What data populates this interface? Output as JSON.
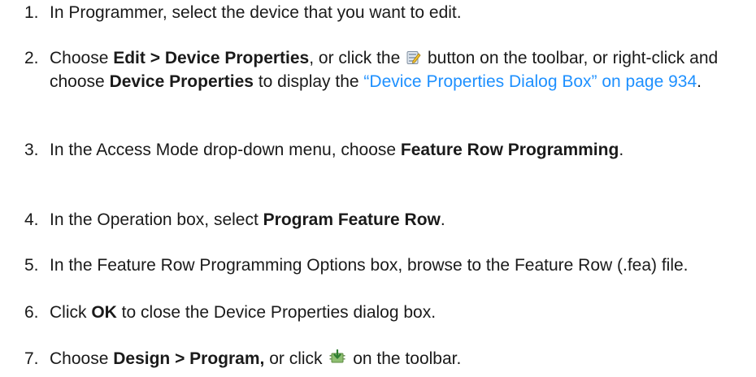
{
  "steps": [
    {
      "number": "1.",
      "text": "In Programmer, select the device that you want to edit."
    },
    {
      "number": "2.",
      "t1": "Choose ",
      "b1": "Edit > Device Properties",
      "t2": ", or click the ",
      "icon": "device-properties-icon",
      "t3": " button on the toolbar, or right-click and choose ",
      "b2": "Device Properties",
      "t4": " to display the ",
      "link": "“Device Properties Dialog Box” on page 934",
      "t5": "."
    },
    {
      "number": "3.",
      "t1": "In the Access Mode drop-down menu, choose ",
      "b1": "Feature Row Programming",
      "t2": "."
    },
    {
      "number": "4.",
      "t1": "In the Operation box, select ",
      "b1": "Program Feature Row",
      "t2": "."
    },
    {
      "number": "5.",
      "text": "In the Feature Row Programming Options box, browse to the Feature Row (.fea) file."
    },
    {
      "number": "6.",
      "t1": "Click ",
      "b1": "OK",
      "t2": " to close the Device Properties dialog box."
    },
    {
      "number": "7.",
      "t1": "Choose ",
      "b1": "Design > Program,",
      "t2": " or click ",
      "icon": "program-device-icon",
      "t3": " on the toolbar."
    }
  ],
  "colors": {
    "text": "#1a1a1a",
    "link": "#1e90ff"
  }
}
